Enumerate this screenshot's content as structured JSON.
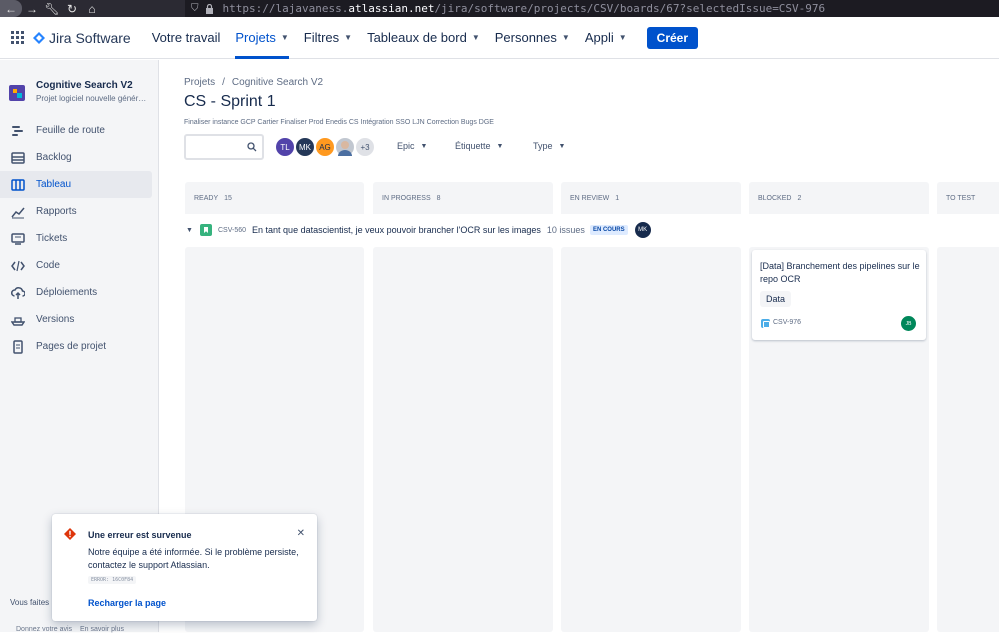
{
  "browser": {
    "url_prefix": "https://lajavaness.",
    "url_domain": "atlassian.net",
    "url_path": "/jira/software/projects/CSV/boards/67?selectedIssue=CSV-976"
  },
  "topnav": {
    "product": "Jira Software",
    "items": [
      "Votre travail",
      "Projets",
      "Filtres",
      "Tableaux de bord",
      "Personnes",
      "Appli"
    ],
    "create_label": "Créer"
  },
  "sidebar": {
    "project_name": "Cognitive Search V2",
    "project_type": "Projet logiciel nouvelle génération",
    "items": [
      "Feuille de route",
      "Backlog",
      "Tableau",
      "Rapports",
      "Tickets",
      "Code",
      "Déploiements",
      "Versions",
      "Pages de projet"
    ],
    "footer1": "Vous faites",
    "footer2": "Donnez votre avis",
    "footer3": "En savoir plus"
  },
  "main": {
    "breadcrumb": [
      "Projets",
      "Cognitive Search V2"
    ],
    "title": "CS - Sprint 1",
    "sprint_goal": "Finaliser instance GCP Cartier Finaliser Prod Enedis CS Intégration SSO LJN Correction Bugs DGE",
    "avatars": [
      "TL",
      "MK",
      "AG",
      "",
      "+3"
    ],
    "filters": [
      "Epic",
      "Étiquette",
      "Type"
    ]
  },
  "board": {
    "columns": [
      {
        "name": "READY",
        "count": "15"
      },
      {
        "name": "IN PROGRESS",
        "count": "8"
      },
      {
        "name": "EN REVIEW",
        "count": "1"
      },
      {
        "name": "BLOCKED",
        "count": "2"
      },
      {
        "name": "TO TEST",
        "count": ""
      }
    ],
    "swimlane": {
      "key": "CSV-560",
      "summary": "En tant que datascientist, je veux pouvoir brancher l'OCR sur les images",
      "issue_count": "10 issues",
      "status": "EN COURS",
      "assignee": "MK"
    },
    "card": {
      "title": "[Data] Branchement des pipelines sur le repo OCR",
      "label": "Data",
      "key": "CSV-976",
      "assignee": "JB"
    }
  },
  "toast": {
    "title": "Une erreur est survenue",
    "message": "Notre équipe a été informée. Si le problème persiste, contactez le support Atlassian.",
    "code": "ERROR: 16C0F84",
    "action": "Recharger la page"
  },
  "colors": {
    "primary": "#0052cc",
    "sidebar_bg": "#f4f5f7",
    "error": "#de350b"
  }
}
